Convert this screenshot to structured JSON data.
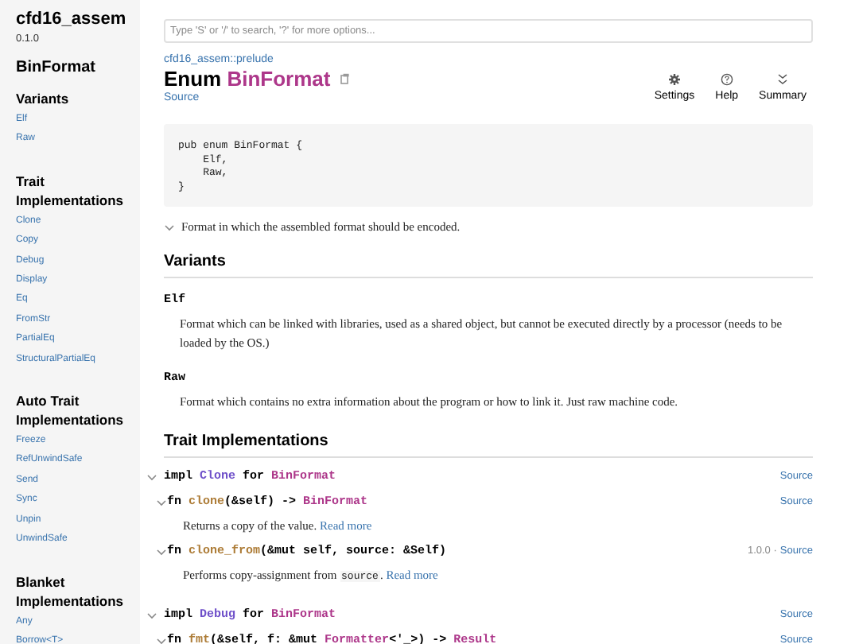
{
  "sidebar": {
    "crate": "cfd16_assem",
    "version": "0.1.0",
    "title": "BinFormat",
    "sections": [
      {
        "heading": "Variants",
        "links": [
          "Elf",
          "Raw"
        ]
      },
      {
        "heading": "Trait Implementations",
        "links": [
          "Clone",
          "Copy",
          "Debug",
          "Display",
          "Eq",
          "FromStr",
          "PartialEq",
          "StructuralPartialEq"
        ]
      },
      {
        "heading": "Auto Trait Implementations",
        "links": [
          "Freeze",
          "RefUnwindSafe",
          "Send",
          "Sync",
          "Unpin",
          "UnwindSafe"
        ]
      },
      {
        "heading": "Blanket Implementations",
        "links": [
          "Any",
          "Borrow<T>"
        ]
      }
    ]
  },
  "search": {
    "placeholder": "Type 'S' or '/' to search, '?' for more options..."
  },
  "breadcrumb": "cfd16_assem::prelude",
  "heading": {
    "kind_label": "Enum",
    "name": "BinFormat",
    "source": "Source"
  },
  "toolbar": [
    {
      "kind": "settings",
      "label": "Settings"
    },
    {
      "kind": "help",
      "label": "Help"
    },
    {
      "kind": "summary",
      "label": "Summary"
    }
  ],
  "declaration": [
    "pub enum BinFormat {",
    "    Elf,",
    "    Raw,",
    "}"
  ],
  "docblock": {
    "expanded": true,
    "text": "Format in which the assembled format should be encoded."
  },
  "variants": {
    "heading": "Variants",
    "items": [
      {
        "name": "Elf",
        "description": "Format which can be linked with libraries, used as a shared object, but cannot be executed directly by a processor (needs to be loaded by the OS.)"
      },
      {
        "name": "Raw",
        "description": "Format which contains no extra information about the program or how to link it. Just raw machine code."
      }
    ]
  },
  "trait_impls": {
    "heading": "Trait Implementations",
    "items": [
      {
        "kind": "impl",
        "expanded": true,
        "signature": [
          {
            "kind": "plain",
            "text": "impl "
          },
          {
            "kind": "trait",
            "text": "Clone"
          },
          {
            "kind": "plain",
            "text": " for "
          },
          {
            "kind": "type",
            "text": "BinFormat"
          }
        ],
        "source": "Source"
      },
      {
        "kind": "method",
        "expanded": true,
        "signature": [
          {
            "kind": "plain",
            "text": "fn "
          },
          {
            "kind": "fn",
            "text": "clone"
          },
          {
            "kind": "plain",
            "text": "(&self) -> "
          },
          {
            "kind": "type",
            "text": "BinFormat"
          }
        ],
        "source": "Source",
        "doc": [
          {
            "kind": "text",
            "text": "Returns a copy of the value. "
          },
          {
            "kind": "link",
            "text": "Read more"
          }
        ]
      },
      {
        "kind": "method",
        "expanded": true,
        "signature": [
          {
            "kind": "plain",
            "text": "fn "
          },
          {
            "kind": "fn",
            "text": "clone_from"
          },
          {
            "kind": "plain",
            "text": "(&mut self, source: &Self)"
          }
        ],
        "version": "1.0.0 ·",
        "source": "Source",
        "doc": [
          {
            "kind": "text",
            "text": "Performs copy-assignment from "
          },
          {
            "kind": "code",
            "text": "source"
          },
          {
            "kind": "text",
            "text": ". "
          },
          {
            "kind": "link",
            "text": "Read more"
          }
        ]
      },
      {
        "kind": "impl",
        "expanded": true,
        "signature": [
          {
            "kind": "plain",
            "text": "impl "
          },
          {
            "kind": "trait",
            "text": "Debug"
          },
          {
            "kind": "plain",
            "text": " for "
          },
          {
            "kind": "type",
            "text": "BinFormat"
          }
        ],
        "source": "Source"
      },
      {
        "kind": "method",
        "expanded": true,
        "signature": [
          {
            "kind": "plain",
            "text": "fn "
          },
          {
            "kind": "fn",
            "text": "fmt"
          },
          {
            "kind": "plain",
            "text": "(&self, f: &mut "
          },
          {
            "kind": "type",
            "text": "Formatter"
          },
          {
            "kind": "plain",
            "text": "<'_>) -> "
          },
          {
            "kind": "type",
            "text": "Result"
          }
        ],
        "source": "Source"
      }
    ]
  }
}
